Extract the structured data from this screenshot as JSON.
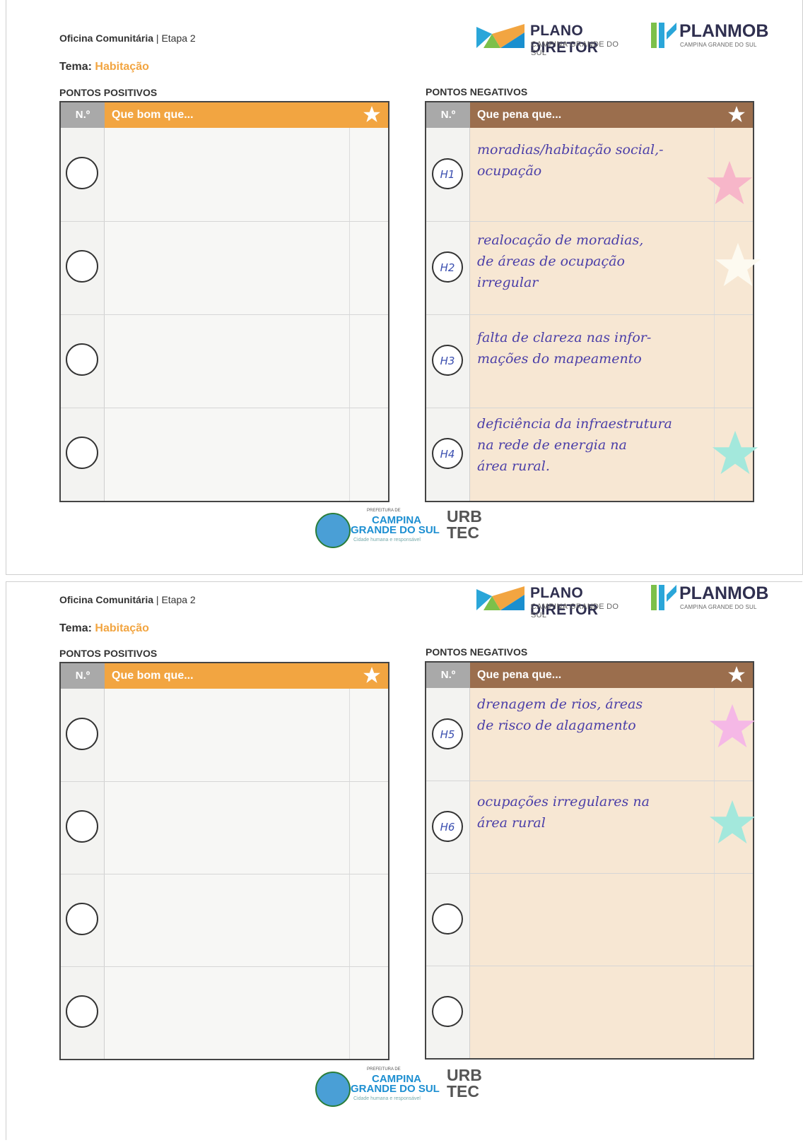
{
  "header": {
    "oficina": "Oficina Comunitária",
    "etapa": "| Etapa 2",
    "tema_label": "Tema:",
    "tema_value": "Habitação",
    "plano_title": "PLANO DIRETOR",
    "plano_sub": "CAMPINA GRANDE DO SUL",
    "planmob_title": "PLANMOB",
    "planmob_sub": "CAMPINA GRANDE DO SUL"
  },
  "sections": {
    "positive_label": "PONTOS POSITIVOS",
    "negative_label": "PONTOS NEGATIVOS",
    "num_header": "N.º",
    "positive_header": "Que bom que...",
    "negative_header": "Que pena que..."
  },
  "footer": {
    "prefeitura": "PREFEITURA DE",
    "campina": "CAMPINA",
    "grande": "GRANDE DO SUL",
    "slogan": "Cidade humana e responsável",
    "urb": "URB",
    "tec": "TEC"
  },
  "sheet1": {
    "negatives": [
      {
        "code": "H1",
        "lines": [
          "moradias/habitação social,-",
          "ocupação"
        ],
        "sticker": "#f7b6c9"
      },
      {
        "code": "H2",
        "lines": [
          "realocação de moradias,",
          "de áreas de ocupação",
          "irregular"
        ],
        "sticker": "#fdfaf0"
      },
      {
        "code": "H3",
        "lines": [
          "falta de clareza nas infor-",
          "mações do mapeamento"
        ],
        "sticker": ""
      },
      {
        "code": "H4",
        "lines": [
          "deficiência da infraestrutura",
          "na rede de energia na",
          "área rural."
        ],
        "sticker": "#a3e8dc"
      }
    ]
  },
  "sheet2": {
    "negatives": [
      {
        "code": "H5",
        "lines": [
          "drenagem de rios, áreas",
          "de risco de alagamento"
        ],
        "sticker": "#f5b8e6"
      },
      {
        "code": "H6",
        "lines": [
          "ocupações irregulares na",
          "área rural"
        ],
        "sticker": "#a3e8dc"
      },
      {
        "code": "",
        "lines": [],
        "sticker": ""
      },
      {
        "code": "",
        "lines": [],
        "sticker": ""
      }
    ]
  }
}
